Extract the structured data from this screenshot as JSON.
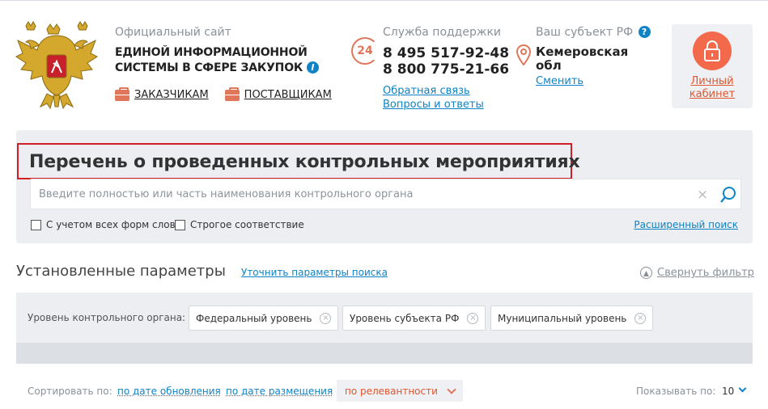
{
  "header": {
    "site_caption": "Официальный сайт",
    "site_name_line1": "Единой информационной",
    "site_name_line2": "системы в сфере закупок",
    "info_icon": "i",
    "customer_link": "ЗАКАЗЧИКАМ",
    "supplier_link": "ПОСТАВЩИКАМ",
    "support": {
      "caption": "Служба поддержки",
      "icon_text": "24",
      "phone1": "8 495 517-92-48",
      "phone2": "8 800 775-21-66",
      "feedback_link": "Обратная связь",
      "faq_link": "Вопросы и ответы"
    },
    "region": {
      "caption": "Ваш субъект РФ",
      "help_icon": "?",
      "name": "Кемеровская обл",
      "change_link": "Сменить"
    },
    "cabinet": {
      "label": "Личный кабинет"
    }
  },
  "search": {
    "title": "Перечень о проведенных контрольных мероприятиях",
    "placeholder": "Введите полностью или часть наименования контрольного органа",
    "clear_icon": "×",
    "option_all_forms": "С учетом всех форм слов",
    "option_strict": "Строгое соответствие",
    "advanced_link": "Расширенный поиск"
  },
  "params": {
    "title": "Установленные параметры",
    "refine_link": "Уточнить параметры поиска",
    "collapse_link": "Свернуть фильтр",
    "filter_label": "Уровень контрольного органа:",
    "chips": [
      "Федеральный уровень",
      "Уровень субъекта РФ",
      "Муниципальный уровень"
    ],
    "chip_remove_icon": "×"
  },
  "sort": {
    "label": "Сортировать по:",
    "by_update": "по дате обновления",
    "by_placement": "по дате размещения",
    "by_relevance": "по релевантности",
    "show_label": "Показывать по:",
    "show_value": "10"
  },
  "colors": {
    "accent_orange": "#e0765a",
    "link_blue": "#0e83c5",
    "highlight_red": "#d32026",
    "panel_gray": "#eceef1"
  }
}
